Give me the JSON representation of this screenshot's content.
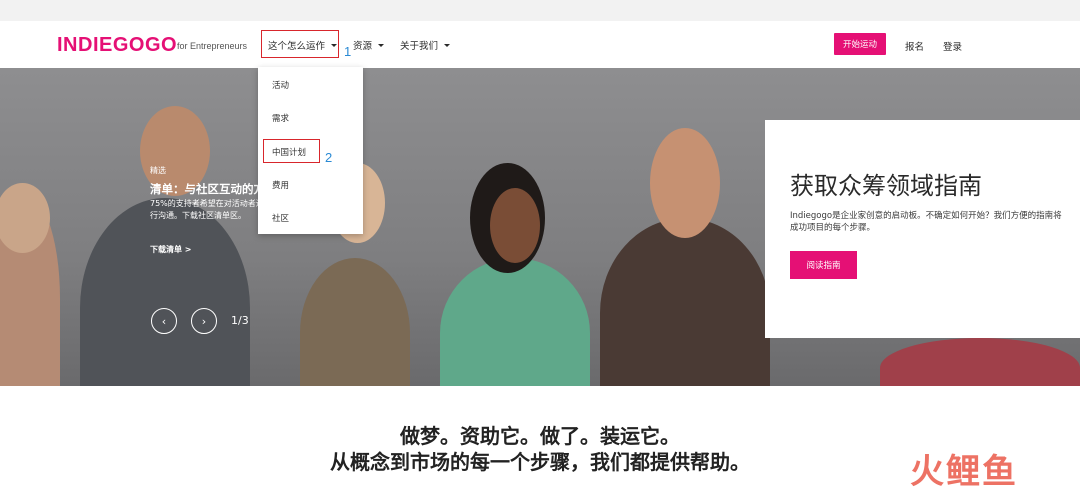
{
  "header": {
    "logo": "INDIEGOGO",
    "logo_sub": "for Entrepreneurs",
    "nav": {
      "how_it_works": "这个怎么运作",
      "resources": "资源",
      "about": "关于我们"
    },
    "start_button": "开始运动",
    "signup": "报名",
    "login": "登录"
  },
  "callouts": [
    "1",
    "2"
  ],
  "dropdown": {
    "items": [
      "活动",
      "需求",
      "中国计划",
      "费用",
      "社区"
    ]
  },
  "hero": {
    "featured": "精选",
    "title": "清单：与社区互动的方",
    "description": "75%的支持者希望在对活动者进行沟通。下载社区清单区。",
    "download_link": "下载清单 >",
    "slide_counter": "1/3",
    "prev_icon": "chevron-left-icon",
    "next_icon": "chevron-right-icon"
  },
  "guide_card": {
    "title": "获取众筹领域指南",
    "description_line1": "Indiegogo是企业家创意的启动板。不确定如何开始？我们方便的指南将",
    "description_line2": "成功项目的每个步骤。",
    "button": "阅读指南"
  },
  "tagline": {
    "line1": "做梦。资助它。做了。装运它。",
    "line2": "从概念到市场的每一个步骤，我们都提供帮助。"
  },
  "watermark": "火鲤鱼",
  "colors": {
    "brand": "#e51075",
    "highlight_box": "#d8262c",
    "callout": "#2a8ad4"
  }
}
